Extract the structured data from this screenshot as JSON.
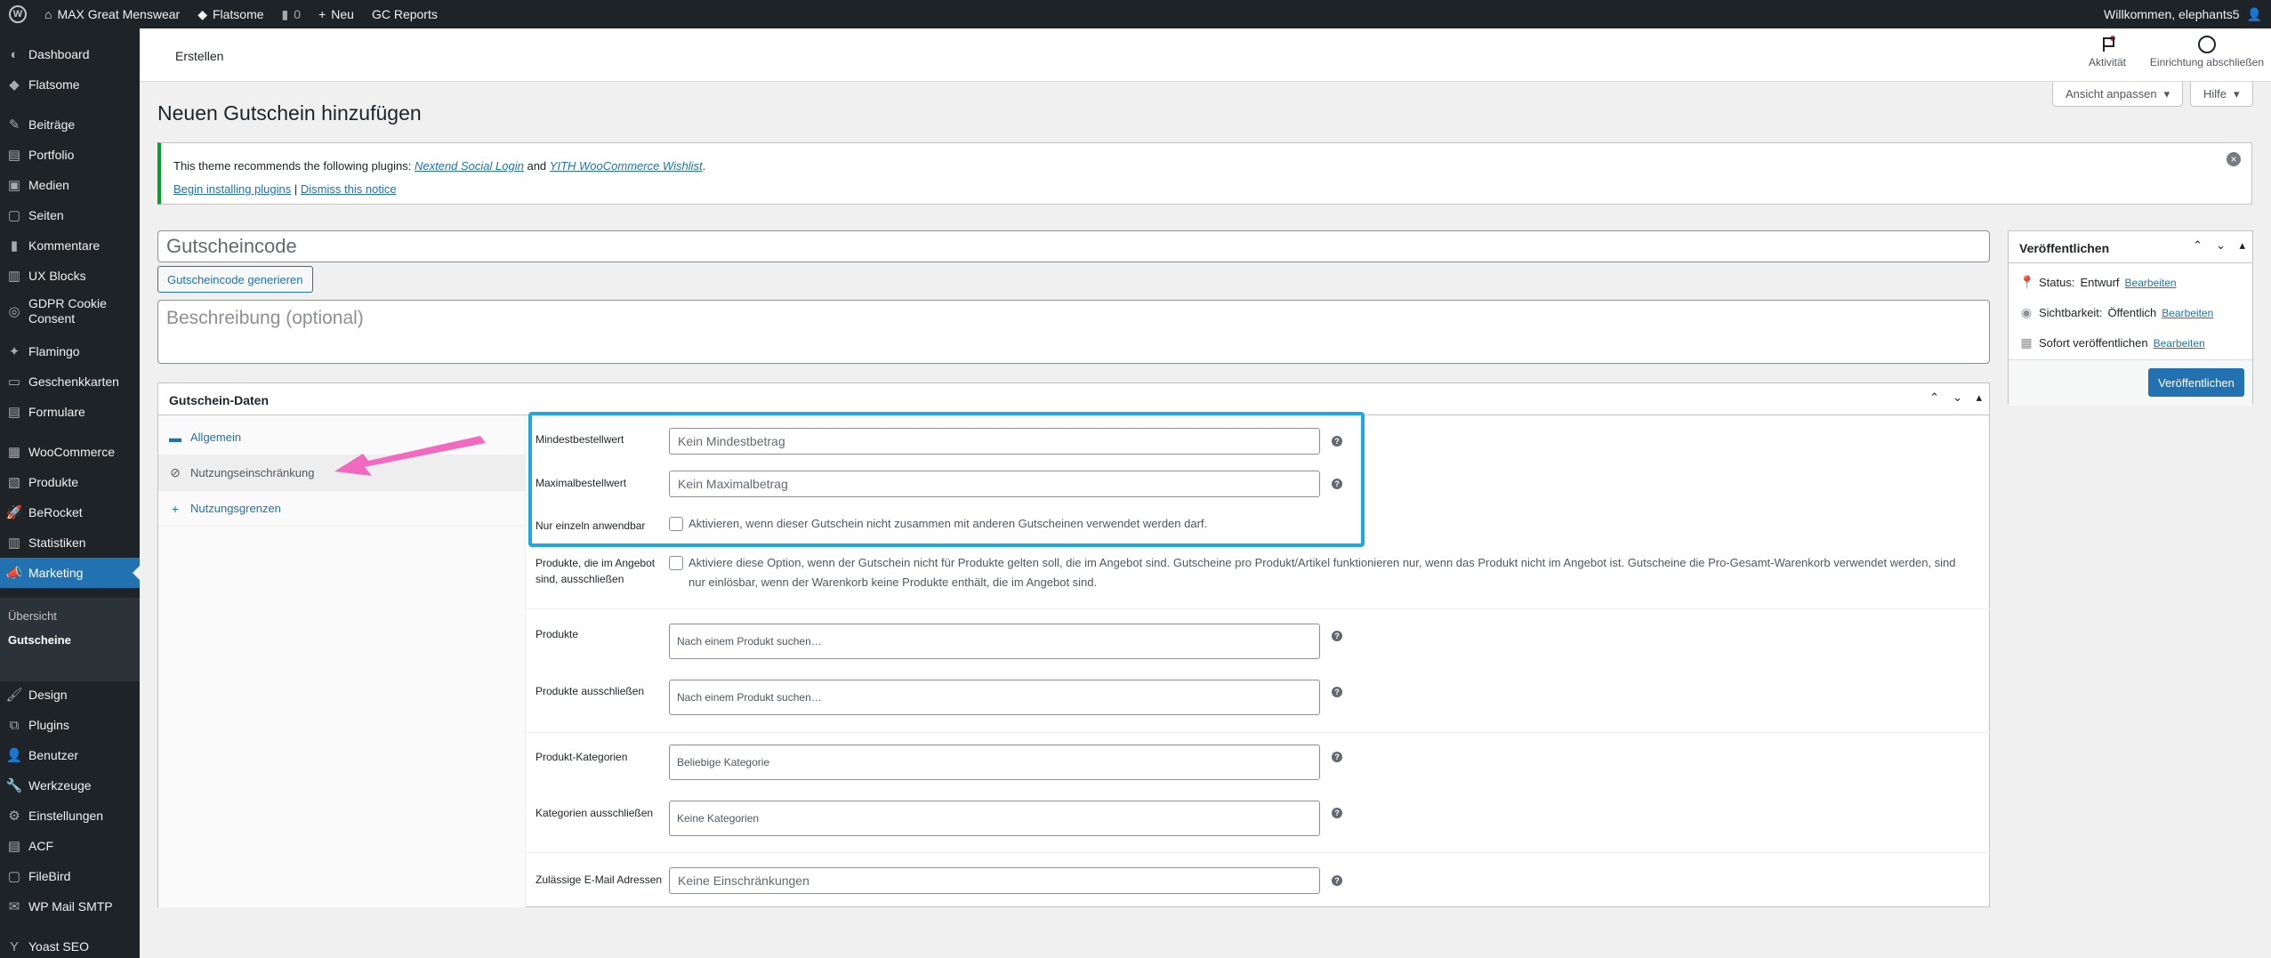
{
  "adminbar": {
    "site_name": "MAX Great Menswear",
    "theme": "Flatsome",
    "comments_count": "0",
    "new_label": "Neu",
    "reports": "GC Reports",
    "greeting": "Willkommen, elephants5"
  },
  "sidebar": {
    "items": [
      {
        "label": "Dashboard",
        "icon": "dashboard-icon"
      },
      {
        "label": "Flatsome",
        "icon": "flatsome-icon"
      },
      {
        "label": "Beiträge",
        "icon": "pin-icon"
      },
      {
        "label": "Portfolio",
        "icon": "portfolio-icon"
      },
      {
        "label": "Medien",
        "icon": "media-icon"
      },
      {
        "label": "Seiten",
        "icon": "pages-icon"
      },
      {
        "label": "Kommentare",
        "icon": "comments-icon"
      },
      {
        "label": "UX Blocks",
        "icon": "blocks-icon"
      },
      {
        "label": "GDPR Cookie Consent",
        "icon": "gdpr-icon"
      },
      {
        "label": "Flamingo",
        "icon": "flamingo-icon"
      },
      {
        "label": "Geschenkkarten",
        "icon": "gift-card-icon"
      },
      {
        "label": "Formulare",
        "icon": "forms-icon"
      },
      {
        "label": "WooCommerce",
        "icon": "woocommerce-icon"
      },
      {
        "label": "Produkte",
        "icon": "products-icon"
      },
      {
        "label": "BeRocket",
        "icon": "rocket-icon"
      },
      {
        "label": "Statistiken",
        "icon": "stats-icon"
      },
      {
        "label": "Marketing",
        "icon": "marketing-icon"
      },
      {
        "label": "Design",
        "icon": "design-icon"
      },
      {
        "label": "Plugins",
        "icon": "plugins-icon"
      },
      {
        "label": "Benutzer",
        "icon": "users-icon"
      },
      {
        "label": "Werkzeuge",
        "icon": "tools-icon"
      },
      {
        "label": "Einstellungen",
        "icon": "settings-icon"
      },
      {
        "label": "ACF",
        "icon": "acf-icon"
      },
      {
        "label": "FileBird",
        "icon": "filebird-icon"
      },
      {
        "label": "WP Mail SMTP",
        "icon": "mail-icon"
      },
      {
        "label": "Yoast SEO",
        "icon": "yoast-icon"
      }
    ],
    "submenu": [
      "Übersicht",
      "Gutscheine"
    ]
  },
  "header": {
    "title": "Erstellen",
    "activity": "Aktivität",
    "finish_setup": "Einrichtung abschließen",
    "screen_options": "Ansicht anpassen",
    "help": "Hilfe"
  },
  "page": {
    "title": "Neuen Gutschein hinzufügen"
  },
  "notice": {
    "prefix": "This theme recommends the following plugins:",
    "plugin1": "Nextend Social Login",
    "and": "and",
    "plugin2": "YITH WooCommerce Wishlist",
    "period": ".",
    "install": "Begin installing plugins",
    "sep": "|",
    "dismiss": "Dismiss this notice"
  },
  "coupon": {
    "code_placeholder": "Gutscheincode",
    "generate": "Gutscheincode generieren",
    "description_placeholder": "Beschreibung (optional)"
  },
  "coupon_data": {
    "title": "Gutschein-Daten",
    "tabs": [
      {
        "label": "Allgemein",
        "icon": "ticket-icon"
      },
      {
        "label": "Nutzungseinschränkung",
        "icon": "restriction-icon"
      },
      {
        "label": "Nutzungsgrenzen",
        "icon": "plus-icon"
      }
    ],
    "fields": {
      "min_label": "Mindestbestellwert",
      "min_placeholder": "Kein Mindestbetrag",
      "max_label": "Maximalbestellwert",
      "max_placeholder": "Kein Maximalbetrag",
      "individual_label": "Nur einzeln anwendbar",
      "individual_text": "Aktivieren, wenn dieser Gutschein nicht zusammen mit anderen Gutscheinen verwendet werden darf.",
      "sale_label": "Produkte, die im Angebot sind, ausschließen",
      "sale_text": "Aktiviere diese Option, wenn der Gutschein nicht für Produkte gelten soll, die im Angebot sind. Gutscheine pro Produkt/Artikel funktionieren nur, wenn das Produkt nicht im Angebot ist. Gutscheine die Pro-Gesamt-Warenkorb verwendet werden, sind nur einlösbar, wenn der Warenkorb keine Produkte enthält, die im Angebot sind.",
      "products_label": "Produkte",
      "products_placeholder": "Nach einem Produkt suchen…",
      "exclude_products_label": "Produkte ausschließen",
      "exclude_products_placeholder": "Nach einem Produkt suchen…",
      "categories_label": "Produkt-Kategorien",
      "categories_placeholder": "Beliebige Kategorie",
      "exclude_categories_label": "Kategorien ausschließen",
      "exclude_categories_placeholder": "Keine Kategorien",
      "emails_label": "Zulässige E-Mail Adressen",
      "emails_placeholder": "Keine Einschränkungen"
    }
  },
  "publish": {
    "title": "Veröffentlichen",
    "status_label": "Status:",
    "status_value": "Entwurf",
    "visibility_label": "Sichtbarkeit:",
    "visibility_value": "Öffentlich",
    "schedule": "Sofort veröffentlichen",
    "edit": "Bearbeiten",
    "button": "Veröffentlichen"
  },
  "colors": {
    "accent": "#2271b1",
    "sidebar_bg": "#1d2327",
    "highlight": "#1ea7e1",
    "arrow": "#f06bc0"
  }
}
